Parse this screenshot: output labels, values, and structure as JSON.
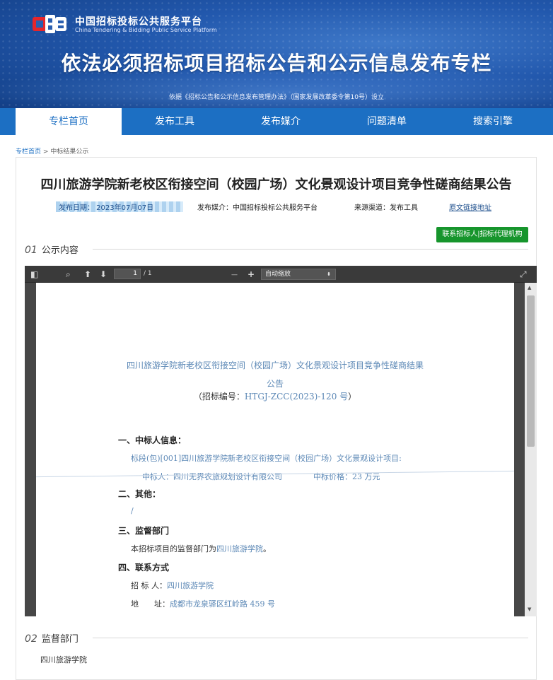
{
  "header": {
    "site_name_cn": "中国招标投标公共服务平台",
    "site_name_en": "China Tendering & Bidding Public Service Platform",
    "banner_title": "依法必须招标项目招标公告和公示信息发布专栏",
    "banner_subtitle": "依据《招标公告和公示信息发布管理办法》（国家发展改革委令第10号）设立"
  },
  "nav": {
    "items": [
      {
        "label": "专栏首页",
        "active": true
      },
      {
        "label": "发布工具"
      },
      {
        "label": "发布媒介"
      },
      {
        "label": "问题清单"
      },
      {
        "label": "搜索引擎"
      }
    ]
  },
  "breadcrumb": {
    "home": "专栏首页",
    "sep": ">",
    "current": "中标结果公示"
  },
  "article": {
    "title": "四川旅游学院新老校区衔接空间（校园广场）文化景观设计项目竞争性磋商结果公告",
    "publish_date": "发布日期：  2023年07月07日",
    "media": "发布媒介：中国招标投标公共服务平台",
    "channel": "来源渠道：发布工具",
    "source_link": "原文链接地址",
    "contact_button": "联系招标人|招标代理机构"
  },
  "sections": {
    "s1": {
      "num": "01",
      "label": "公示内容"
    },
    "s2": {
      "num": "02",
      "label": "监督部门"
    }
  },
  "viewer": {
    "page_current": "1",
    "page_total": "/ 1",
    "zoom": "自动缩放",
    "zoom_minus": "—",
    "zoom_plus": "+"
  },
  "document": {
    "title_line1": "四川旅游学院新老校区衔接空间（校园广场）文化景观设计项目竞争性磋商结果",
    "title_line2": "公告",
    "code_label": "（招标编号：",
    "code_value": "HTGJ-ZCC(2023)-120 号",
    "code_close": "）",
    "h1": "一、中标人信息：",
    "lot": "标段(包)[001]四川旅游学院新老校区衔接空间（校园广场）文化景观设计项目:",
    "winner": "中标人：四川无界农旅规划设计有限公司",
    "price": "中标价格：23 万元",
    "h2": "二、其他：",
    "other": "/",
    "h3": "三、监督部门",
    "supervisor_prefix": "本招标项目的监督部门为",
    "supervisor_name": "四川旅游学院",
    "supervisor_suffix": "。",
    "h4": "四、联系方式",
    "tenderer_label": "招 标 人：",
    "tenderer_value": "四川旅游学院",
    "address_label": "地　　址：",
    "address_value": "成都市龙泉驿区红岭路 459 号"
  },
  "supervisor_section_text": "四川旅游学院",
  "colors": {
    "nav_blue": "#1c6fc3",
    "green": "#16952c",
    "doc_blue": "#5c88b6"
  }
}
